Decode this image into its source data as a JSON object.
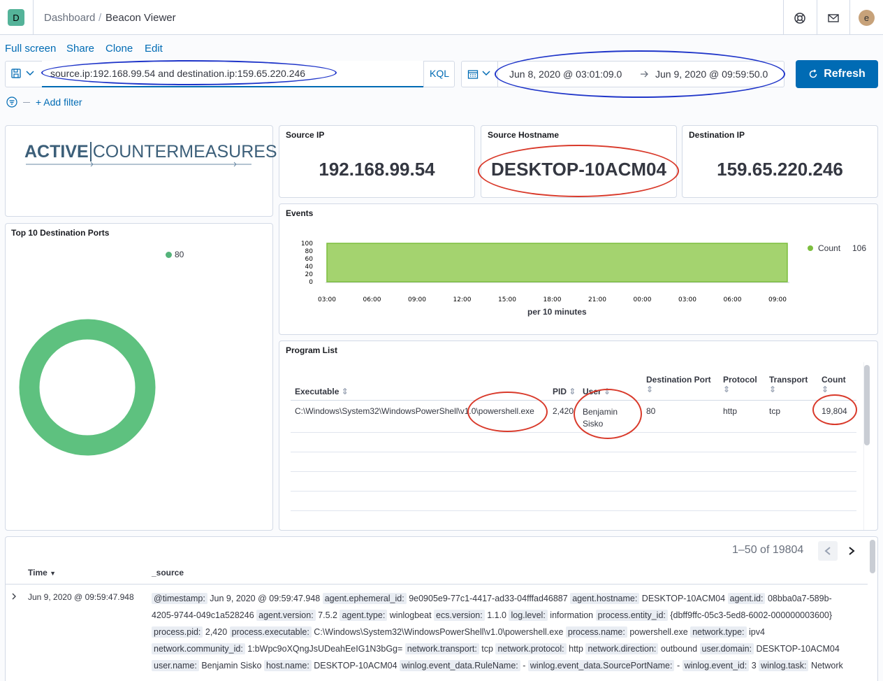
{
  "topbar": {
    "app_letter": "D",
    "crumb_dashboard": "Dashboard",
    "crumb_current": "Beacon Viewer",
    "avatar_letter": "e"
  },
  "menu": {
    "full_screen": "Full screen",
    "share": "Share",
    "clone": "Clone",
    "edit": "Edit"
  },
  "query": {
    "value": "source.ip:192.168.99.54 and destination.ip:159.65.220.246",
    "language": "KQL",
    "add_filter": "+ Add filter"
  },
  "time": {
    "start": "Jun 8, 2020 @ 03:01:09.0",
    "end": "Jun 9, 2020 @ 09:59:50.0",
    "refresh_label": "Refresh"
  },
  "logo": {
    "text_left": "ACTIVE",
    "text_right": "COUNTERMEASURES"
  },
  "metrics": [
    {
      "title": "Source IP",
      "value": "192.168.99.54"
    },
    {
      "title": "Source Hostname",
      "value": "DESKTOP-10ACM04"
    },
    {
      "title": "Destination IP",
      "value": "159.65.220.246"
    }
  ],
  "ports_panel": {
    "title": "Top 10 Destination Ports",
    "legend": "80"
  },
  "events_panel": {
    "title": "Events",
    "legend_label": "Count",
    "legend_value": "106",
    "xlabel": "per 10 minutes"
  },
  "chart_data": [
    {
      "type": "area",
      "title": "Events",
      "xlabel": "per 10 minutes",
      "ylabel": "",
      "x_ticks": [
        "03:00",
        "06:00",
        "09:00",
        "12:00",
        "15:00",
        "18:00",
        "21:00",
        "00:00",
        "03:00",
        "06:00",
        "09:00"
      ],
      "y_ticks": [
        "0",
        "20",
        "40",
        "60",
        "80",
        "100"
      ],
      "ylim": [
        0,
        100
      ],
      "series": [
        {
          "name": "Count",
          "values": [
            100,
            100,
            100,
            100,
            100,
            100,
            100,
            100,
            100,
            100,
            100
          ],
          "color": "#7dbe3f"
        }
      ],
      "legend_value": "106",
      "legend": "right"
    },
    {
      "type": "pie",
      "title": "Top 10 Destination Ports",
      "labels": [
        "80"
      ],
      "values": [
        100
      ],
      "colors": [
        "#54b37a"
      ],
      "donut": true,
      "legend": "top"
    }
  ],
  "program_list": {
    "title": "Program List",
    "headers": [
      "Executable",
      "PID",
      "User",
      "Destination Port",
      "Protocol",
      "Transport",
      "Count"
    ],
    "rows": [
      {
        "executable": "C:\\Windows\\System32\\WindowsPowerShell\\v1.0\\powershell.exe",
        "pid": "2,420",
        "user": "Benjamin Sisko",
        "port": "80",
        "protocol": "http",
        "transport": "tcp",
        "count": "19,804"
      }
    ]
  },
  "docs": {
    "pagination": "1–50 of 19804",
    "col_time": "Time",
    "col_source": "_source",
    "row_time": "Jun 9, 2020 @ 09:59:47.948",
    "line1": [
      [
        "@timestamp:",
        "Jun 9, 2020 @ 09:59:47.948"
      ],
      [
        "agent.ephemeral_id:",
        "9e0905e9-77c1-4417-ad33-04fffad46887"
      ],
      [
        "agent.hostname:",
        "DESKTOP-10ACM04"
      ],
      [
        "agent.id:",
        "08bba0a7-589b-"
      ]
    ],
    "line2_lead": "4205-9744-049c1a528246",
    "line2": [
      [
        "agent.version:",
        "7.5.2"
      ],
      [
        "agent.type:",
        "winlogbeat"
      ],
      [
        "ecs.version:",
        "1.1.0"
      ],
      [
        "log.level:",
        "information"
      ],
      [
        "process.entity_id:",
        "{dbff9ffc-05c3-5ed8-6002-000000003600}"
      ]
    ],
    "line3": [
      [
        "process.pid:",
        "2,420"
      ],
      [
        "process.executable:",
        "C:\\Windows\\System32\\WindowsPowerShell\\v1.0\\powershell.exe"
      ],
      [
        "process.name:",
        "powershell.exe"
      ],
      [
        "network.type:",
        "ipv4"
      ]
    ],
    "line4": [
      [
        "network.community_id:",
        "1:bWpc9oXQngJsUDeahEeIG1N3bGg="
      ],
      [
        "network.transport:",
        "tcp"
      ],
      [
        "network.protocol:",
        "http"
      ],
      [
        "network.direction:",
        "outbound"
      ],
      [
        "user.domain:",
        "DESKTOP-10ACM04"
      ]
    ],
    "line5": [
      [
        "user.name:",
        "Benjamin Sisko"
      ],
      [
        "host.name:",
        "DESKTOP-10ACM04"
      ],
      [
        "winlog.event_data.RuleName:",
        "-"
      ],
      [
        "winlog.event_data.SourcePortName:",
        "-"
      ],
      [
        "winlog.event_id:",
        "3"
      ],
      [
        "winlog.task:",
        "Network"
      ]
    ]
  }
}
